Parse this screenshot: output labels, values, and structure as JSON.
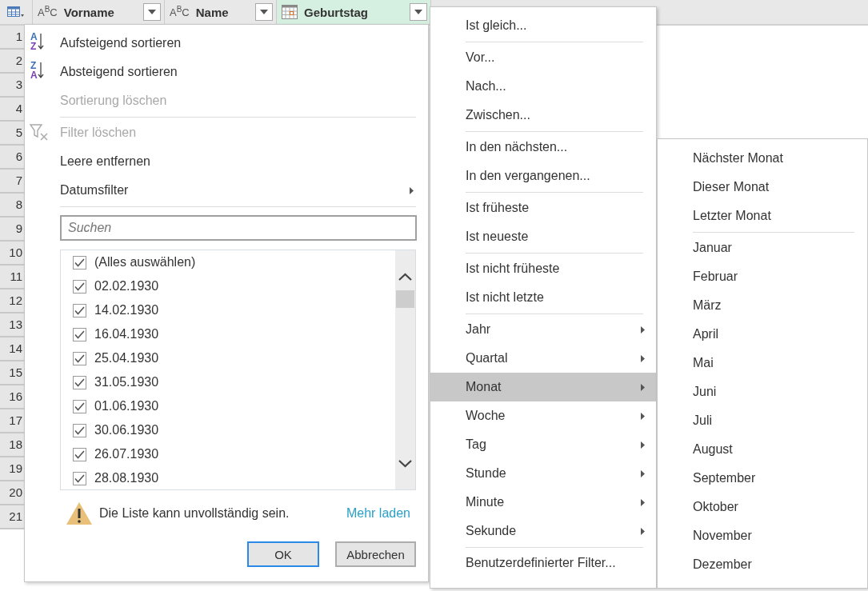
{
  "table": {
    "columns": [
      {
        "kind": "text",
        "type_badge": "A$^{B}$C",
        "label": "Vorname",
        "selected": false
      },
      {
        "kind": "text",
        "type_badge": "A$^{B}$C",
        "label": "Name",
        "selected": false
      },
      {
        "kind": "date",
        "label": "Geburtstag",
        "selected": true
      }
    ],
    "row_numbers": [
      "1",
      "2",
      "3",
      "4",
      "5",
      "6",
      "7",
      "8",
      "9",
      "10",
      "11",
      "12",
      "13",
      "14",
      "15",
      "16",
      "17",
      "18",
      "19",
      "20",
      "21"
    ]
  },
  "column_menu": {
    "items": [
      {
        "kind": "sort",
        "icon_text": "AZ",
        "label": "Aufsteigend sortieren",
        "disabled": false,
        "submenu": false
      },
      {
        "kind": "sort",
        "icon_text": "ZA",
        "label": "Absteigend sortieren",
        "disabled": false,
        "submenu": false
      },
      {
        "kind": "item",
        "label": "Sortierung löschen",
        "disabled": true,
        "submenu": false
      },
      {
        "kind": "separator"
      },
      {
        "kind": "clear-filter",
        "label": "Filter löschen",
        "disabled": true,
        "submenu": false
      },
      {
        "kind": "item",
        "label": "Leere entfernen",
        "disabled": false,
        "submenu": false
      },
      {
        "kind": "item",
        "label": "Datumsfilter",
        "disabled": false,
        "submenu": true
      },
      {
        "kind": "separator"
      }
    ],
    "search": {
      "placeholder": "Suchen"
    },
    "values": [
      {
        "label": "(Alles auswählen)",
        "checked": true
      },
      {
        "label": "02.02.1930",
        "checked": true
      },
      {
        "label": "14.02.1930",
        "checked": true
      },
      {
        "label": "16.04.1930",
        "checked": true
      },
      {
        "label": "25.04.1930",
        "checked": true
      },
      {
        "label": "31.05.1930",
        "checked": true
      },
      {
        "label": "01.06.1930",
        "checked": true
      },
      {
        "label": "30.06.1930",
        "checked": true
      },
      {
        "label": "26.07.1930",
        "checked": true
      },
      {
        "label": "28.08.1930",
        "checked": true
      }
    ],
    "warning": "Die Liste kann unvollständig sein.",
    "load_more": "Mehr laden",
    "buttons": [
      {
        "label": "OK",
        "default": true
      },
      {
        "label": "Abbrechen",
        "default": false
      }
    ]
  },
  "date_filter_menu": {
    "items": [
      {
        "kind": "item",
        "label": "Ist gleich...",
        "submenu": false,
        "selected": false
      },
      {
        "kind": "separator"
      },
      {
        "kind": "item",
        "label": "Vor...",
        "submenu": false,
        "selected": false
      },
      {
        "kind": "item",
        "label": "Nach...",
        "submenu": false,
        "selected": false
      },
      {
        "kind": "item",
        "label": "Zwischen...",
        "submenu": false,
        "selected": false
      },
      {
        "kind": "separator"
      },
      {
        "kind": "item",
        "label": "In den nächsten...",
        "submenu": false,
        "selected": false
      },
      {
        "kind": "item",
        "label": "In den vergangenen...",
        "submenu": false,
        "selected": false
      },
      {
        "kind": "separator"
      },
      {
        "kind": "item",
        "label": "Ist früheste",
        "submenu": false,
        "selected": false
      },
      {
        "kind": "item",
        "label": "Ist neueste",
        "submenu": false,
        "selected": false
      },
      {
        "kind": "separator"
      },
      {
        "kind": "item",
        "label": "Ist nicht früheste",
        "submenu": false,
        "selected": false
      },
      {
        "kind": "item",
        "label": "Ist nicht letzte",
        "submenu": false,
        "selected": false
      },
      {
        "kind": "separator"
      },
      {
        "kind": "item",
        "label": "Jahr",
        "submenu": true,
        "selected": false
      },
      {
        "kind": "item",
        "label": "Quartal",
        "submenu": true,
        "selected": false
      },
      {
        "kind": "item",
        "label": "Monat",
        "submenu": true,
        "selected": true
      },
      {
        "kind": "item",
        "label": "Woche",
        "submenu": true,
        "selected": false
      },
      {
        "kind": "item",
        "label": "Tag",
        "submenu": true,
        "selected": false
      },
      {
        "kind": "item",
        "label": "Stunde",
        "submenu": true,
        "selected": false
      },
      {
        "kind": "item",
        "label": "Minute",
        "submenu": true,
        "selected": false
      },
      {
        "kind": "item",
        "label": "Sekunde",
        "submenu": true,
        "selected": false
      },
      {
        "kind": "separator"
      },
      {
        "kind": "item",
        "label": "Benutzerdefinierter Filter...",
        "submenu": false,
        "selected": false
      }
    ]
  },
  "month_menu": {
    "items": [
      {
        "kind": "item",
        "label": "Nächster Monat"
      },
      {
        "kind": "item",
        "label": "Dieser Monat"
      },
      {
        "kind": "item",
        "label": "Letzter Monat"
      },
      {
        "kind": "separator"
      },
      {
        "kind": "item",
        "label": "Januar"
      },
      {
        "kind": "item",
        "label": "Februar"
      },
      {
        "kind": "item",
        "label": "März"
      },
      {
        "kind": "item",
        "label": "April"
      },
      {
        "kind": "item",
        "label": "Mai"
      },
      {
        "kind": "item",
        "label": "Juni"
      },
      {
        "kind": "item",
        "label": "Juli"
      },
      {
        "kind": "item",
        "label": "August"
      },
      {
        "kind": "item",
        "label": "September"
      },
      {
        "kind": "item",
        "label": "Oktober"
      },
      {
        "kind": "item",
        "label": "November"
      },
      {
        "kind": "item",
        "label": "Dezember"
      }
    ]
  }
}
